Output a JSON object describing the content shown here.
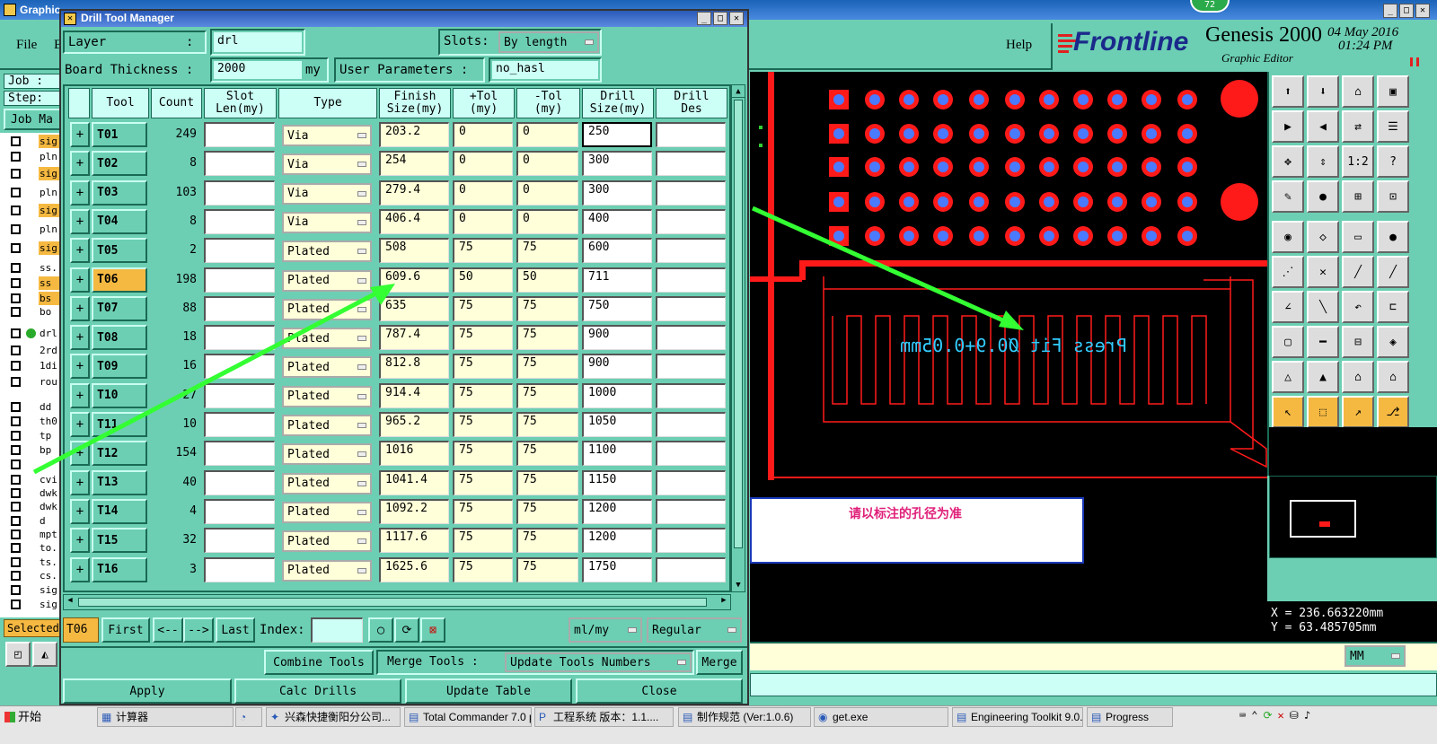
{
  "app": {
    "window_title": "Graphic",
    "menu": {
      "file": "File",
      "edit_fragment": "E",
      "help": "Help"
    },
    "brand": {
      "logo": "Frontline",
      "product": "Genesis 2000",
      "subtitle": "Graphic Editor",
      "date": "04 May 2016",
      "time": "01:24 PM"
    },
    "left_panel": {
      "job_label": "Job : ",
      "step_label": "Step: ",
      "job_manager_fragment": "Job Ma",
      "selected_label": "Selected"
    },
    "layers": [
      "sig",
      "pln",
      "sig",
      "pln",
      "sig",
      "pln",
      "sig",
      "ss.",
      "ss",
      "bs",
      "bo",
      "drl",
      "2rd",
      "1di",
      "rou",
      "dd",
      "th0",
      "tp",
      "bp",
      "",
      "cvi",
      "dwk",
      "dwk",
      "d",
      "mpt",
      "to.",
      "ts.",
      "cs.",
      "sig",
      "sig"
    ],
    "coords": {
      "x": "X = 236.663220mm",
      "y": "Y = 63.485705mm"
    },
    "units_dropdown": "MM",
    "badge": "72"
  },
  "canvas": {
    "annotation_text": "Press Fit Ø0.9+0.05mm",
    "note_box_text": "请以标注的孔径为准",
    "colors": {
      "trace": "#ff1a1a",
      "drill": "#4a7aff",
      "annotation": "#33ccff",
      "arrow": "#33ff33"
    }
  },
  "dialog": {
    "title": "Drill Tool Manager",
    "layer_label": "Layer",
    "layer_colon": ":",
    "layer_value": "drl",
    "slots_label": "Slots:",
    "slots_value": "By length",
    "thickness_label": "Board Thickness :",
    "thickness_value": "2000",
    "thickness_unit": "my",
    "user_params_label": "User Parameters :",
    "user_params_value": "no_hasl",
    "columns": [
      "Tool",
      "Count",
      "Slot\nLen(my)",
      "Type",
      "Finish\nSize(my)",
      "+Tol\n(my)",
      "-Tol\n(my)",
      "Drill\nSize(my)",
      "Drill\nDes"
    ],
    "rows": [
      {
        "tool": "T01",
        "count": "249",
        "type": "Via",
        "finish": "203.2",
        "ptol": "0",
        "mtol": "0",
        "drill": "250"
      },
      {
        "tool": "T02",
        "count": "8",
        "type": "Via",
        "finish": "254",
        "ptol": "0",
        "mtol": "0",
        "drill": "300"
      },
      {
        "tool": "T03",
        "count": "103",
        "type": "Via",
        "finish": "279.4",
        "ptol": "0",
        "mtol": "0",
        "drill": "300"
      },
      {
        "tool": "T04",
        "count": "8",
        "type": "Via",
        "finish": "406.4",
        "ptol": "0",
        "mtol": "0",
        "drill": "400"
      },
      {
        "tool": "T05",
        "count": "2",
        "type": "Plated",
        "finish": "508",
        "ptol": "75",
        "mtol": "75",
        "drill": "600"
      },
      {
        "tool": "T06",
        "count": "198",
        "type": "Plated",
        "finish": "609.6",
        "ptol": "50",
        "mtol": "50",
        "drill": "711"
      },
      {
        "tool": "T07",
        "count": "88",
        "type": "Plated",
        "finish": "635",
        "ptol": "75",
        "mtol": "75",
        "drill": "750"
      },
      {
        "tool": "T08",
        "count": "18",
        "type": "Plated",
        "finish": "787.4",
        "ptol": "75",
        "mtol": "75",
        "drill": "900"
      },
      {
        "tool": "T09",
        "count": "16",
        "type": "Plated",
        "finish": "812.8",
        "ptol": "75",
        "mtol": "75",
        "drill": "900"
      },
      {
        "tool": "T10",
        "count": "27",
        "type": "Plated",
        "finish": "914.4",
        "ptol": "75",
        "mtol": "75",
        "drill": "1000"
      },
      {
        "tool": "T11",
        "count": "10",
        "type": "Plated",
        "finish": "965.2",
        "ptol": "75",
        "mtol": "75",
        "drill": "1050"
      },
      {
        "tool": "T12",
        "count": "154",
        "type": "Plated",
        "finish": "1016",
        "ptol": "75",
        "mtol": "75",
        "drill": "1100"
      },
      {
        "tool": "T13",
        "count": "40",
        "type": "Plated",
        "finish": "1041.4",
        "ptol": "75",
        "mtol": "75",
        "drill": "1150"
      },
      {
        "tool": "T14",
        "count": "4",
        "type": "Plated",
        "finish": "1092.2",
        "ptol": "75",
        "mtol": "75",
        "drill": "1200"
      },
      {
        "tool": "T15",
        "count": "32",
        "type": "Plated",
        "finish": "1117.6",
        "ptol": "75",
        "mtol": "75",
        "drill": "1200"
      },
      {
        "tool": "T16",
        "count": "3",
        "type": "Plated",
        "finish": "1625.6",
        "ptol": "75",
        "mtol": "75",
        "drill": "1750"
      }
    ],
    "selected_tool": "T06",
    "nav": {
      "current": "T06",
      "first": "First",
      "prev": "<--",
      "next": "-->",
      "last": "Last",
      "index_label": "Index:",
      "units": "ml/my",
      "mode": "Regular"
    },
    "actions": {
      "combine": "Combine Tools",
      "merge_label": "Merge Tools :",
      "update_numbers": "Update Tools Numbers",
      "merge": "Merge",
      "apply": "Apply",
      "calc": "Calc Drills",
      "update_table": "Update Table",
      "close": "Close"
    }
  },
  "taskbar": {
    "start": "开始",
    "items": [
      "计算器",
      "",
      "兴森快捷衡阳分公司...",
      "Total Commander 7.0 p...",
      "工程系统 版本：1.1....",
      "制作规范 (Ver:1.0.6)",
      "get.exe",
      "Engineering Toolkit 9.0...",
      "Progress"
    ]
  }
}
